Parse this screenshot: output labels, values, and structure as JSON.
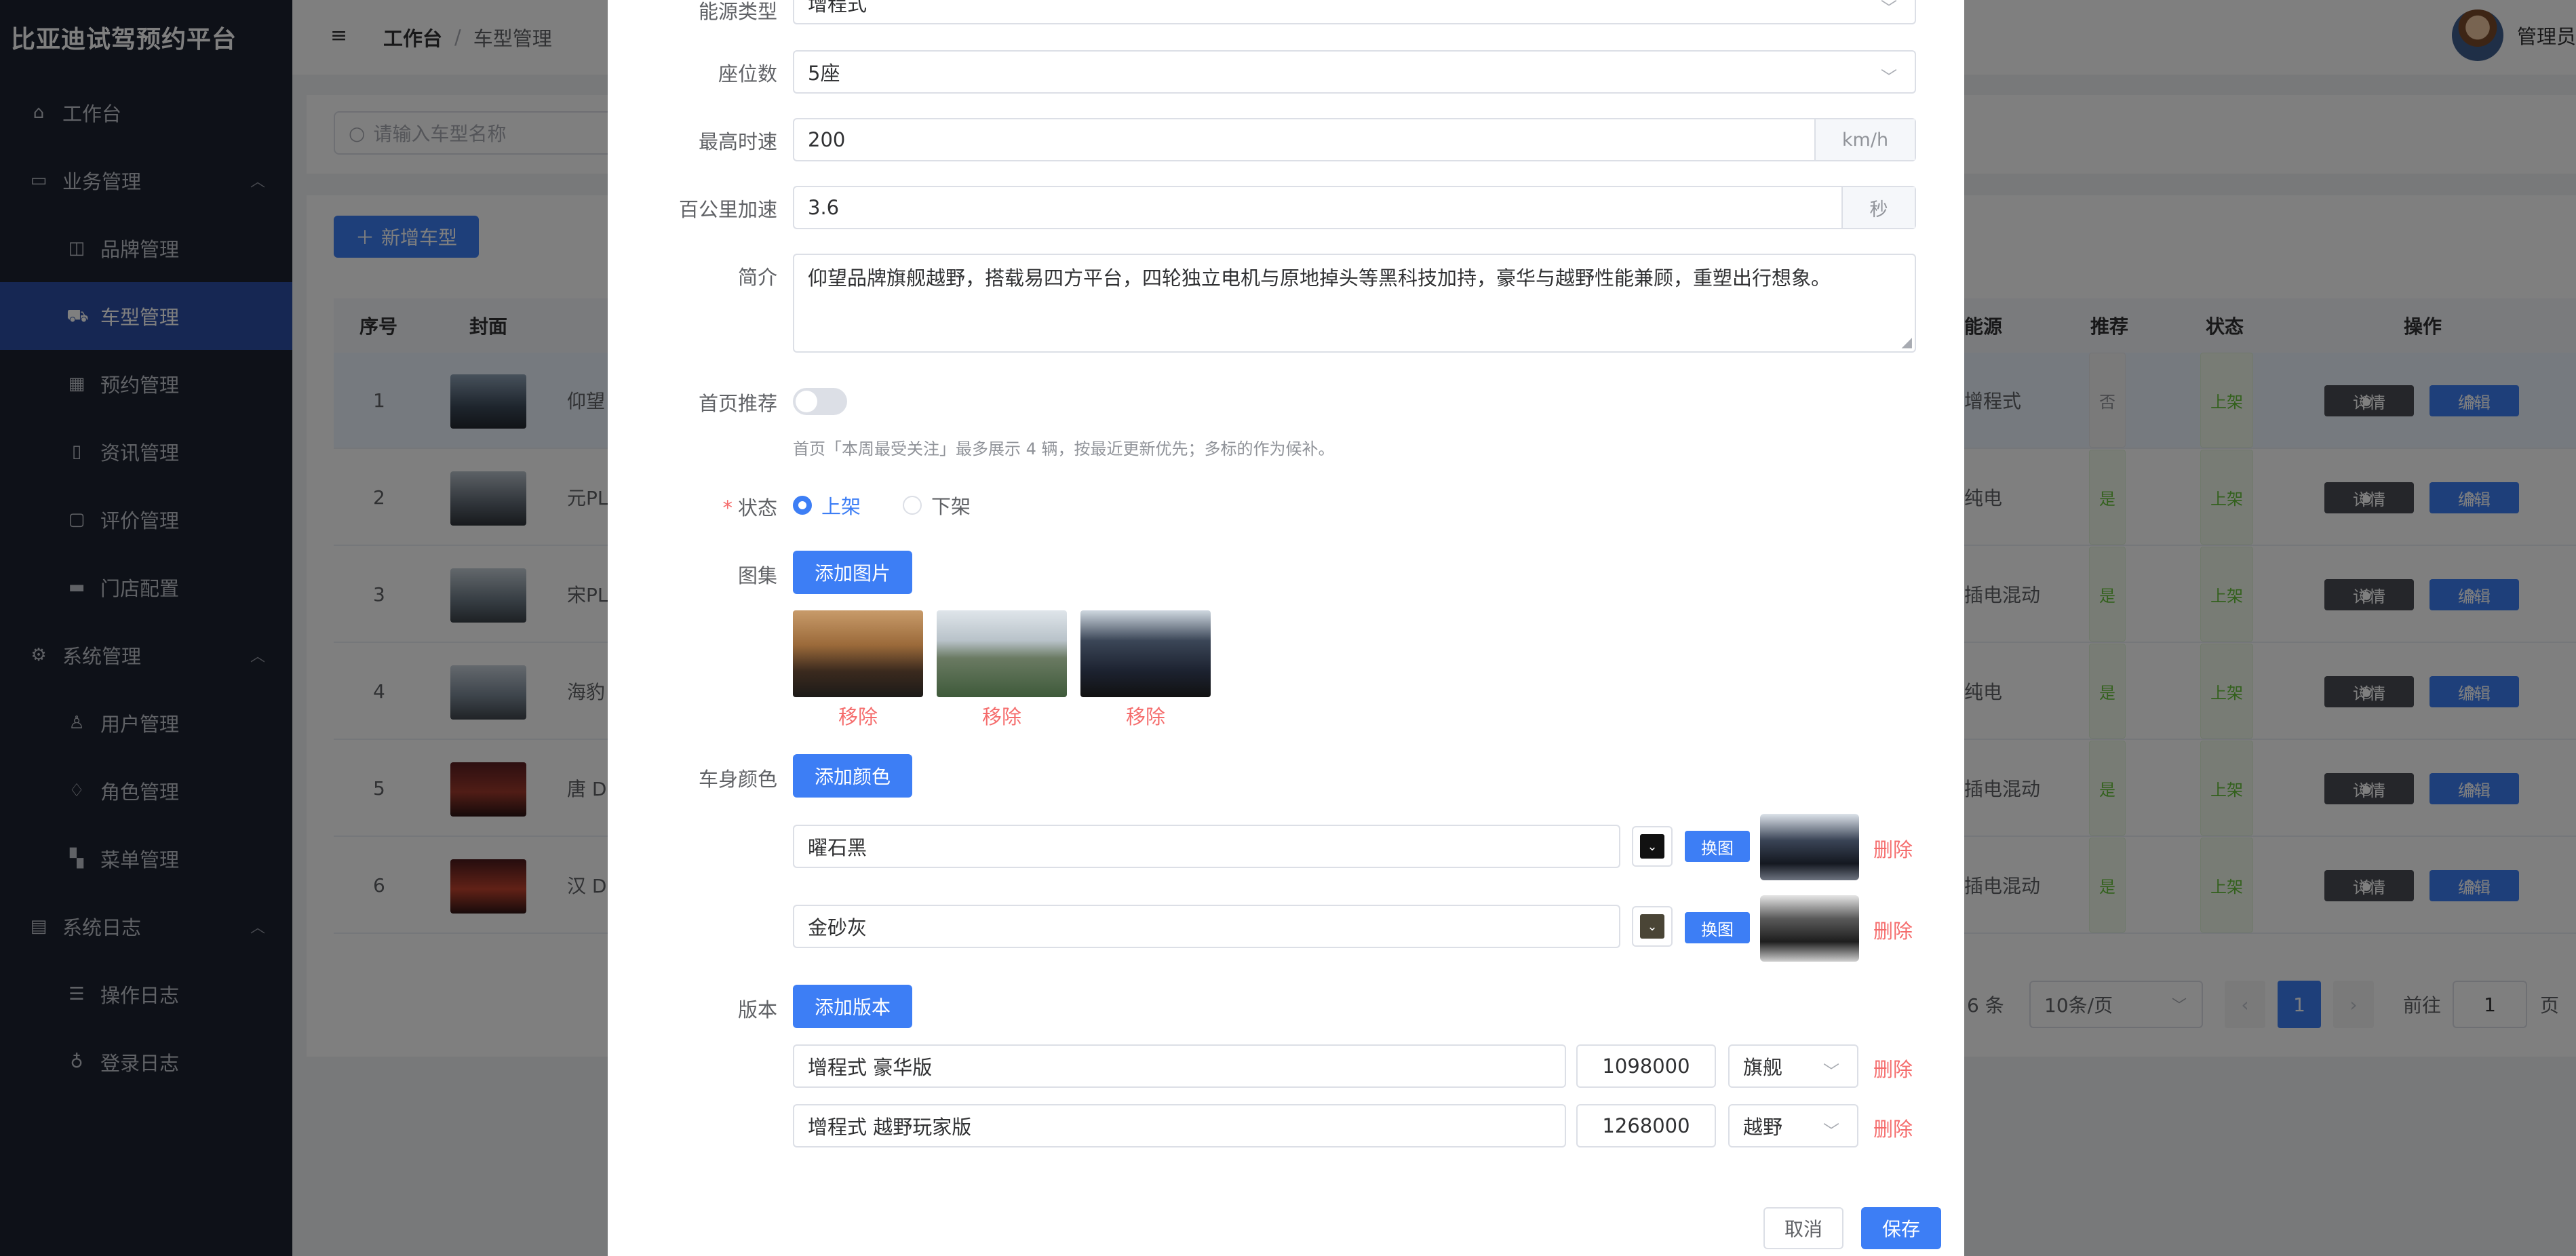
{
  "app": {
    "title": "比亚迪试驾预约平台"
  },
  "sidebar": {
    "items": [
      {
        "label": "工作台",
        "icon": "home-icon"
      },
      {
        "label": "业务管理",
        "icon": "briefcase-icon"
      },
      {
        "label": "品牌管理",
        "icon": "cup-icon"
      },
      {
        "label": "车型管理",
        "icon": "car-icon"
      },
      {
        "label": "预约管理",
        "icon": "calendar-icon"
      },
      {
        "label": "资讯管理",
        "icon": "notebook-icon"
      },
      {
        "label": "评价管理",
        "icon": "comment-icon"
      },
      {
        "label": "门店配置",
        "icon": "store-icon"
      },
      {
        "label": "系统管理",
        "icon": "gear-icon"
      },
      {
        "label": "用户管理",
        "icon": "user-icon"
      },
      {
        "label": "角色管理",
        "icon": "lightbulb-icon"
      },
      {
        "label": "菜单管理",
        "icon": "grid-icon"
      },
      {
        "label": "系统日志",
        "icon": "document-icon"
      },
      {
        "label": "操作日志",
        "icon": "sliders-icon"
      },
      {
        "label": "登录日志",
        "icon": "lock-icon"
      }
    ]
  },
  "header": {
    "breadcrumb": [
      "工作台",
      "车型管理"
    ],
    "breadcrumb_sep": "/",
    "user": "管理员"
  },
  "list": {
    "search_placeholder": "请输入车型名称",
    "add_button": "新增车型",
    "columns": [
      "序号",
      "封面",
      "能源",
      "推荐",
      "状态",
      "操作"
    ],
    "rows": [
      {
        "index": "1",
        "name": "仰望",
        "energy": "增程式",
        "recommend": "否",
        "status": "上架"
      },
      {
        "index": "2",
        "name": "元PL",
        "energy": "纯电",
        "recommend": "是",
        "status": "上架"
      },
      {
        "index": "3",
        "name": "宋PL",
        "energy": "插电混动",
        "recommend": "是",
        "status": "上架"
      },
      {
        "index": "4",
        "name": "海豹",
        "energy": "纯电",
        "recommend": "是",
        "status": "上架"
      },
      {
        "index": "5",
        "name": "唐 DI",
        "energy": "插电混动",
        "recommend": "是",
        "status": "上架"
      },
      {
        "index": "6",
        "name": "汉 DI",
        "energy": "插电混动",
        "recommend": "是",
        "status": "上架"
      }
    ],
    "detail_label": "详情",
    "edit_label": "编辑",
    "pager": {
      "total": "6 条",
      "page_size": "10条/页",
      "current": "1",
      "goto_label": "前往",
      "goto_value": "1",
      "page_suffix": "页"
    }
  },
  "dialog": {
    "energy": {
      "label": "能源类型",
      "value": "增程式"
    },
    "seats": {
      "label": "座位数",
      "value": "5座"
    },
    "top_speed": {
      "label": "最高时速",
      "value": "200",
      "unit": "km/h"
    },
    "accel": {
      "label": "百公里加速",
      "value": "3.6",
      "unit": "秒"
    },
    "intro": {
      "label": "简介",
      "value": "仰望品牌旗舰越野，搭载易四方平台，四轮独立电机与原地掉头等黑科技加持，豪华与越野性能兼顾，重塑出行想象。"
    },
    "recommend": {
      "label": "首页推荐",
      "on": false,
      "hint": "首页「本周最受关注」最多展示 4 辆，按最近更新优先；多标的作为候补。"
    },
    "status": {
      "label": "状态",
      "required_mark": "*",
      "options": [
        "上架",
        "下架"
      ],
      "selected": "上架"
    },
    "gallery": {
      "label": "图集",
      "add_button": "添加图片",
      "remove_label": "移除",
      "images": [
        "suv-desert-photo",
        "suv-mountain-photo",
        "car-interior-photo"
      ]
    },
    "colors": {
      "label": "车身颜色",
      "add_button": "添加颜色",
      "swap_label": "换图",
      "delete_label": "删除",
      "items": [
        {
          "name": "曜石黑",
          "swatch": "#111111"
        },
        {
          "name": "金砂灰",
          "swatch": "#4a4536"
        }
      ]
    },
    "versions": {
      "label": "版本",
      "add_button": "添加版本",
      "delete_label": "删除",
      "items": [
        {
          "name": "增程式 豪华版",
          "price": "1098000",
          "tag": "旗舰"
        },
        {
          "name": "增程式 越野玩家版",
          "price": "1268000",
          "tag": "越野"
        }
      ]
    },
    "cancel": "取消",
    "save": "保存"
  },
  "colors": {
    "primary": "#3d7ef5",
    "danger": "#f56c6c",
    "sidebar_bg": "#1d2230",
    "sidebar_active": "#2d4ea6",
    "success": "#67c23a"
  }
}
